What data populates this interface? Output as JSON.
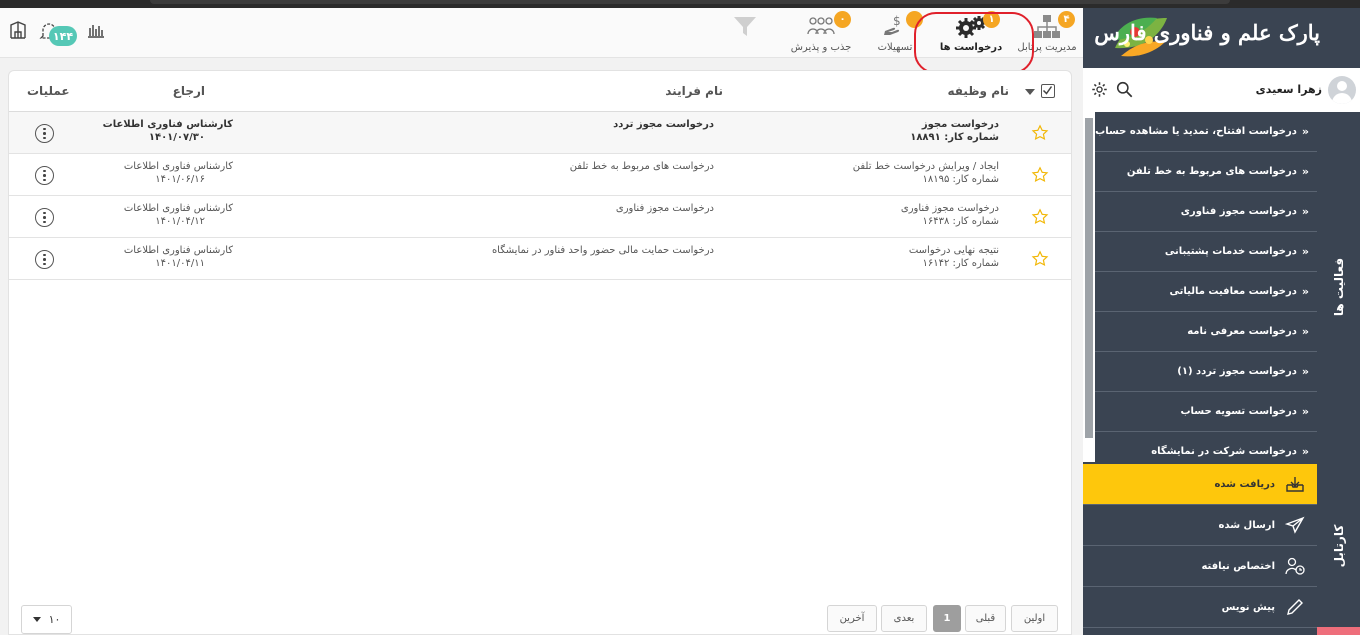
{
  "colors": {
    "accent": "#fec70c",
    "badge": "#f5a623",
    "sidebar": "#3a4452",
    "highlight_ring": "#e0202b",
    "notif": "#55c8b6"
  },
  "header": {
    "notification_count": "۱۴۴",
    "nav": [
      {
        "label": "مدیریت پرتابل",
        "badge": "۴",
        "icon": "org-chart-icon"
      },
      {
        "label": "درخواست ها",
        "badge": "۱",
        "icon": "gears-icon"
      },
      {
        "label": "تسهیلات",
        "badge": "",
        "icon": "hand-money-icon"
      },
      {
        "label": "جذب و پذیرش",
        "badge": "۰",
        "icon": "people-group-icon"
      }
    ]
  },
  "table": {
    "headers": {
      "task": "نام وظیفه",
      "process": "نام فرایند",
      "referral": "ارجاع",
      "actions": "عملیات"
    },
    "rows": [
      {
        "task": "درخواست مجوز",
        "job_no": "شماره کار: ۱۸۸۹۱",
        "process": "درخواست مجوز تردد",
        "ref_role": "کارشناس فناوری اطلاعات",
        "ref_date": "۱۴۰۱/۰۷/۳۰"
      },
      {
        "task": "ایجاد / ویرایش درخواست خط تلفن",
        "job_no": "شماره کار: ۱۸۱۹۵",
        "process": "درخواست های مربوط به خط تلفن",
        "ref_role": "کارشناس فناوری اطلاعات",
        "ref_date": "۱۴۰۱/۰۶/۱۶"
      },
      {
        "task": "درخواست مجوز فناوری",
        "job_no": "شماره کار: ۱۶۴۳۸",
        "process": "درخواست مجوز فناوری",
        "ref_role": "کارشناس فناوری اطلاعات",
        "ref_date": "۱۴۰۱/۰۴/۱۲"
      },
      {
        "task": "نتیجه نهایی درخواست",
        "job_no": "شماره کار: ۱۶۱۴۲",
        "process": "درخواست حمایت مالی حضور واحد فناور در نمایشگاه",
        "ref_role": "کارشناس فناوری اطلاعات",
        "ref_date": "۱۴۰۱/۰۴/۱۱"
      }
    ]
  },
  "pagination": {
    "first": "اولین",
    "prev": "قبلی",
    "current": "1",
    "next": "بعدی",
    "last": "آخرین",
    "page_size": "۱۰"
  },
  "sidebar": {
    "logo_text": "پارک علم و فناوری فارس",
    "user_name": "زهرا سعیدی",
    "activities_tab": "فعالیت ها",
    "activities": [
      "درخواست افتتاح، تمدید یا مشاهده حساب اینترنت",
      "درخواست های مربوط به خط تلفن",
      "درخواست مجوز فناوری",
      "درخواست خدمات پشتیبانی",
      "درخواست معافیت مالیاتی",
      "درخواست معرفی نامه",
      "درخواست مجوز تردد (۱)",
      "درخواست تسویه حساب",
      "درخواست شرکت در نمایشگاه"
    ],
    "cartable_tab": "کارتابل",
    "cartable": [
      {
        "label": "دریافت شده",
        "icon": "inbox-icon"
      },
      {
        "label": "ارسال شده",
        "icon": "send-icon"
      },
      {
        "label": "اختصاص نیافته",
        "icon": "user-clock-icon"
      },
      {
        "label": "پیش نویس",
        "icon": "pencil-icon"
      }
    ]
  }
}
